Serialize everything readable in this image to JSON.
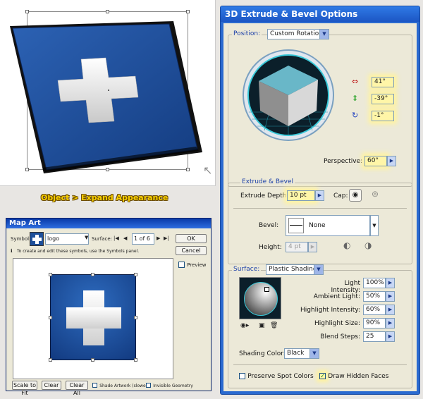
{
  "expand_label": "Object > Expand Appearance",
  "map_art": {
    "title": "Map Art",
    "symbol_label": "Symbol:",
    "symbol_value": "logo",
    "surface_label": "Surface:",
    "surface_value": "1 of 6",
    "hint": "To create and edit these symbols, use the Symbols panel.",
    "ok": "OK",
    "cancel": "Cancel",
    "preview": "Preview",
    "scale_to_fit": "Scale to Fit",
    "clear": "Clear",
    "clear_all": "Clear All",
    "shade_artwork": "Shade Artwork (slower)",
    "invisible_geometry": "Invisible Geometry"
  },
  "extrude": {
    "title": "3D Extrude & Bevel Options",
    "position_label": "Position:",
    "position_value": "Custom Rotation",
    "rot_x": "41°",
    "rot_y": "-39°",
    "rot_z": "-1°",
    "perspective_label": "Perspective:",
    "perspective_value": "60°",
    "extrude_group": "Extrude & Bevel",
    "extrude_depth_label": "Extrude Depth:",
    "extrude_depth_value": "10 pt",
    "cap_label": "Cap:",
    "bevel_label": "Bevel:",
    "bevel_value": "None",
    "height_label": "Height:",
    "height_value": "4 pt",
    "surface_label": "Surface:",
    "surface_value": "Plastic Shading",
    "light_intensity_label": "Light Intensity:",
    "light_intensity": "100%",
    "ambient_light_label": "Ambient Light:",
    "ambient_light": "50%",
    "highlight_intensity_label": "Highlight Intensity:",
    "highlight_intensity": "60%",
    "highlight_size_label": "Highlight Size:",
    "highlight_size": "90%",
    "blend_steps_label": "Blend Steps:",
    "blend_steps": "25",
    "shading_color_label": "Shading Color:",
    "shading_color": "Black",
    "preserve_spot": "Preserve Spot Colors",
    "draw_hidden": "Draw Hidden Faces"
  },
  "colors": {
    "logo_blue": "#1d4f9a",
    "accent_yellow": "#f8d000",
    "dialog_blue": "#2a6ad0"
  }
}
